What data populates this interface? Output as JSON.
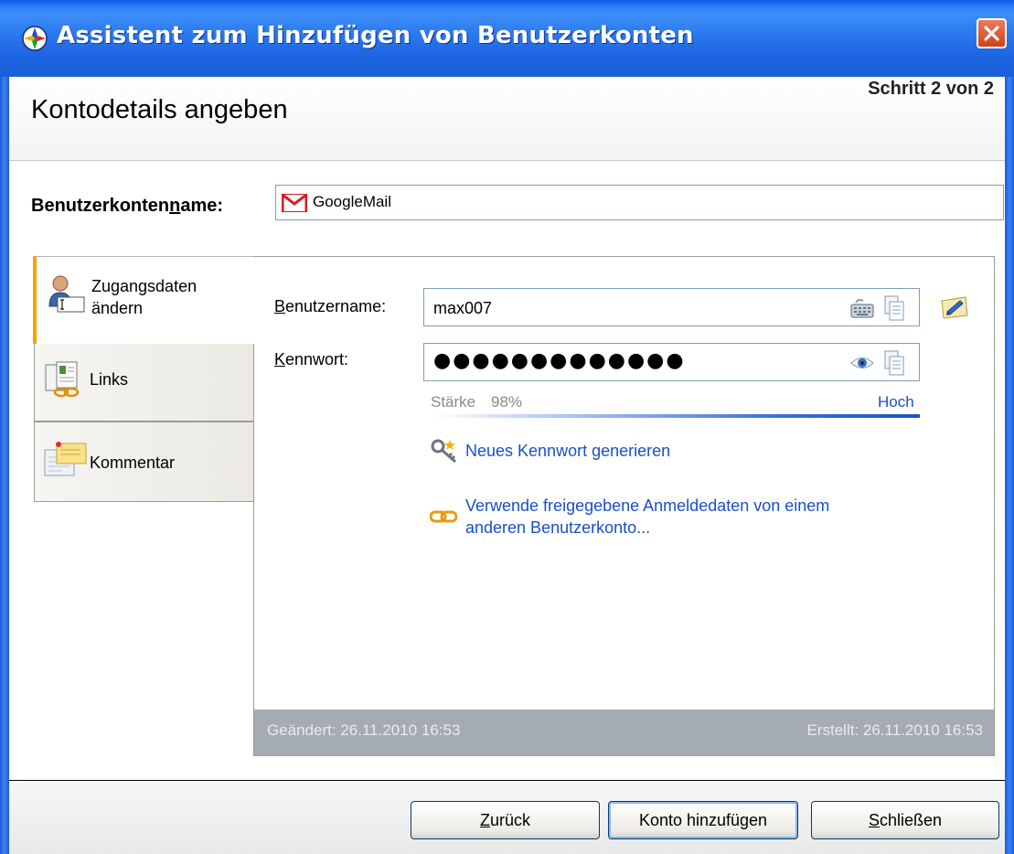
{
  "window": {
    "title": "Assistent zum Hinzufügen von Benutzerkonten",
    "icon": "app-icon",
    "close_icon": "close-icon"
  },
  "header": {
    "page_title": "Kontodetails angeben",
    "step": "Schritt 2 von 2"
  },
  "account": {
    "label_prefix": "Benutzerkonten",
    "label_mnemonic": "n",
    "label_suffix": "ame:",
    "name": "GoogleMail",
    "icon": "gmail-icon"
  },
  "tabs": [
    {
      "label_line1": "Zugangsdaten",
      "label_line2": "ändern",
      "icon": "user-credentials-icon",
      "active": true
    },
    {
      "label": "Links",
      "icon": "links-icon",
      "active": false
    },
    {
      "label": "Kommentar",
      "icon": "comment-icon",
      "active": false
    }
  ],
  "form": {
    "username_label_mnemonic": "B",
    "username_label_rest": "enutzername:",
    "username": "max007",
    "password_label_mnemonic": "K",
    "password_label_rest": "ennwort:",
    "password_masked": "●●●●●●●●●●●●●",
    "strength_label": "Stärke",
    "strength_value": "98%",
    "strength_percent": 98,
    "strength_level": "Hoch",
    "generate_prefix": "Neues Kennwort ",
    "generate_mnemonic": "g",
    "generate_suffix": "enerieren",
    "shared_line1": "Verwende freigegebene Anmeldedaten von einem",
    "shared_line2": "anderen Benutzerkonto..."
  },
  "panel_footer": {
    "modified": "Geändert: 26.11.2010 16:53",
    "created": "Erstellt: 26.11.2010 16:53"
  },
  "buttons": {
    "back_mnemonic": "Z",
    "back_rest": "urück",
    "add": "Konto hinzufügen",
    "close_mnemonic": "S",
    "close_rest": "chließen"
  },
  "colors": {
    "titlebar": "#2a7df6",
    "link": "#1a4fc8",
    "active_tab_accent": "#f5a500"
  }
}
